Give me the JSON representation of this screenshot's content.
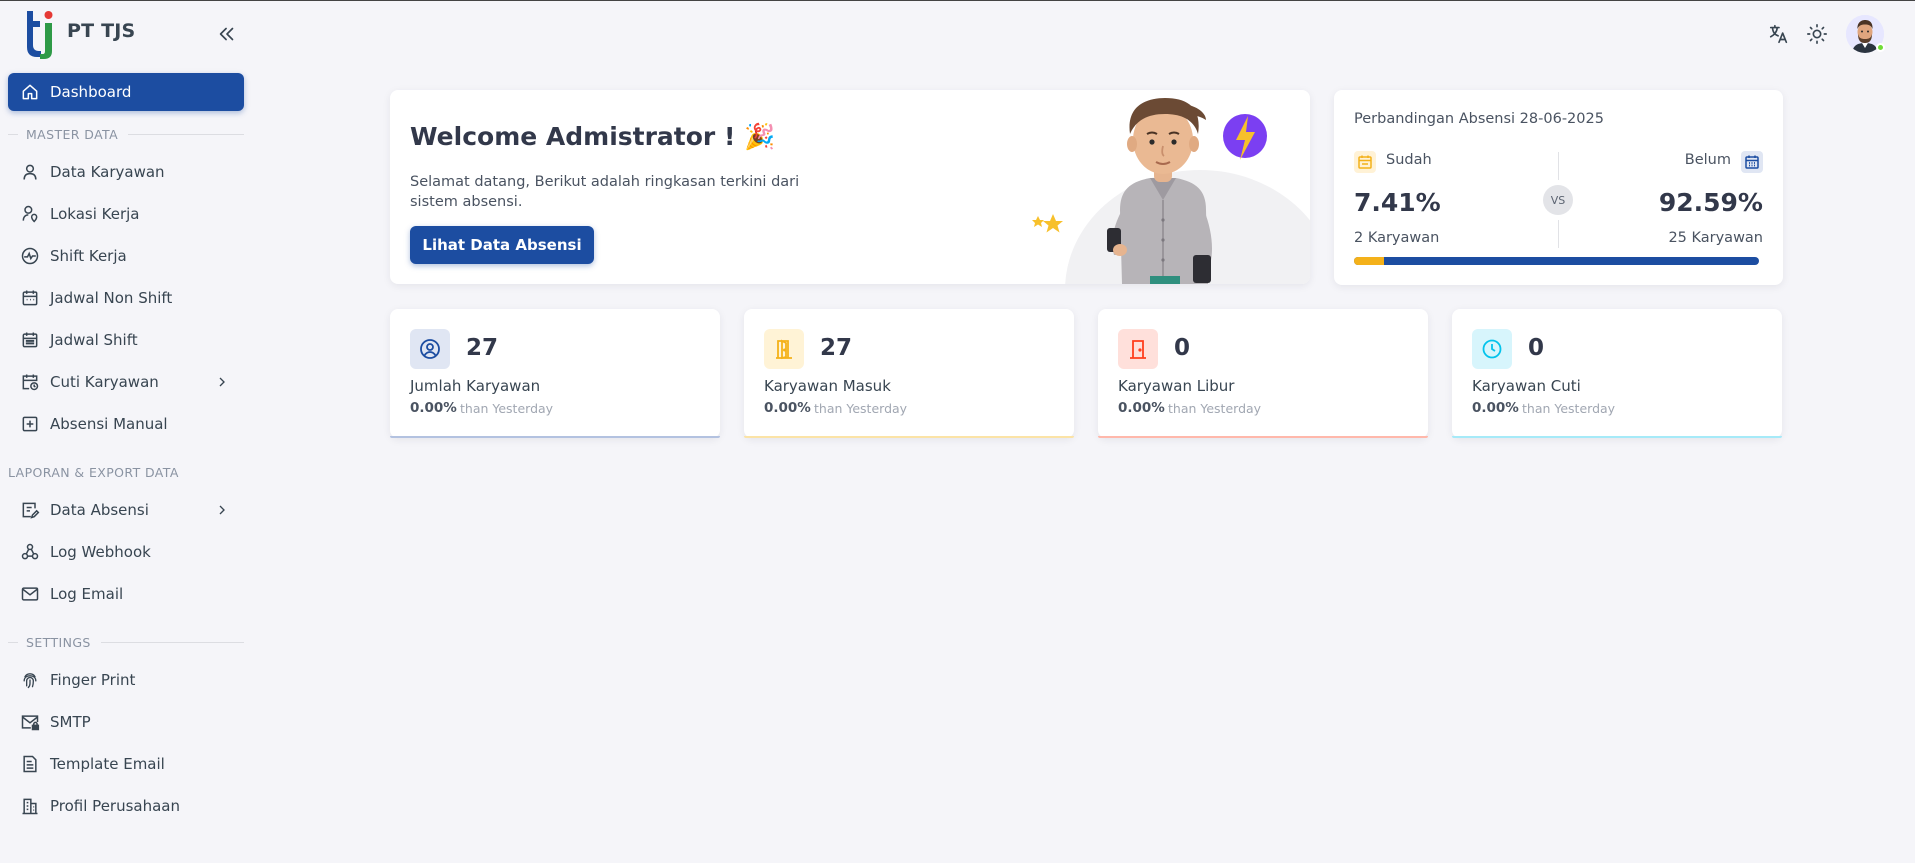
{
  "brand": {
    "name": "PT TJS"
  },
  "sidebar": {
    "items_top": [
      {
        "label": "Dashboard",
        "icon": "home-icon",
        "active": true
      }
    ],
    "sections": [
      {
        "header": "MASTER DATA",
        "items": [
          {
            "label": "Data Karyawan",
            "icon": "user-icon"
          },
          {
            "label": "Lokasi Kerja",
            "icon": "user-pin-icon"
          },
          {
            "label": "Shift Kerja",
            "icon": "activity-icon"
          },
          {
            "label": "Jadwal Non Shift",
            "icon": "calendar-icon"
          },
          {
            "label": "Jadwal Shift",
            "icon": "calendar-list-icon"
          },
          {
            "label": "Cuti Karyawan",
            "icon": "calendar-clock-icon",
            "submenu": true
          },
          {
            "label": "Absensi Manual",
            "icon": "square-plus-icon"
          }
        ]
      },
      {
        "header": "LAPORAN & EXPORT DATA",
        "items": [
          {
            "label": "Data Absensi",
            "icon": "edit-list-icon",
            "submenu": true
          },
          {
            "label": "Log Webhook",
            "icon": "webhook-icon"
          },
          {
            "label": "Log Email",
            "icon": "mail-icon"
          }
        ]
      },
      {
        "header": "SETTINGS",
        "items": [
          {
            "label": "Finger Print",
            "icon": "fingerprint-icon"
          },
          {
            "label": "SMTP",
            "icon": "mail-lock-icon"
          },
          {
            "label": "Template Email",
            "icon": "template-icon"
          },
          {
            "label": "Profil Perusahaan",
            "icon": "building-icon"
          }
        ]
      }
    ]
  },
  "topbar": {
    "icons": [
      "translate-icon",
      "sun-icon"
    ]
  },
  "welcome": {
    "title": "Welcome Admistrator ! 🎉",
    "subtitle": "Selamat datang, Berikut adalah ringkasan terkini dari sistem absensi.",
    "button": "Lihat Data Absensi"
  },
  "compare": {
    "title": "Perbandingan Absensi 28-06-2025",
    "left": {
      "label": "Sudah",
      "percent": "7.41%",
      "count": "2 Karyawan"
    },
    "right": {
      "label": "Belum",
      "percent": "92.59%",
      "count": "25 Karyawan"
    },
    "vs": "VS",
    "progress_fraction": 0.0741,
    "colors": {
      "done": "#f4b11a",
      "pending": "#1c4da1"
    }
  },
  "stats": [
    {
      "value": "27",
      "label": "Jumlah Karyawan",
      "delta": "0.00%",
      "hint": "than Yesterday",
      "icon": "user-circle-icon",
      "color": "#1c4da1",
      "bg": "#e0e6f3"
    },
    {
      "value": "27",
      "label": "Karyawan Masuk",
      "delta": "0.00%",
      "hint": "than Yesterday",
      "icon": "door-enter-icon",
      "color": "#f4b11a",
      "bg": "#fff3d6"
    },
    {
      "value": "0",
      "label": "Karyawan Libur",
      "delta": "0.00%",
      "hint": "than Yesterday",
      "icon": "door-closed-icon",
      "color": "#ff3e1d",
      "bg": "#ffe0db"
    },
    {
      "value": "0",
      "label": "Karyawan Cuti",
      "delta": "0.00%",
      "hint": "than Yesterday",
      "icon": "clock-icon",
      "color": "#03c3ec",
      "bg": "#d7f5fc"
    }
  ]
}
